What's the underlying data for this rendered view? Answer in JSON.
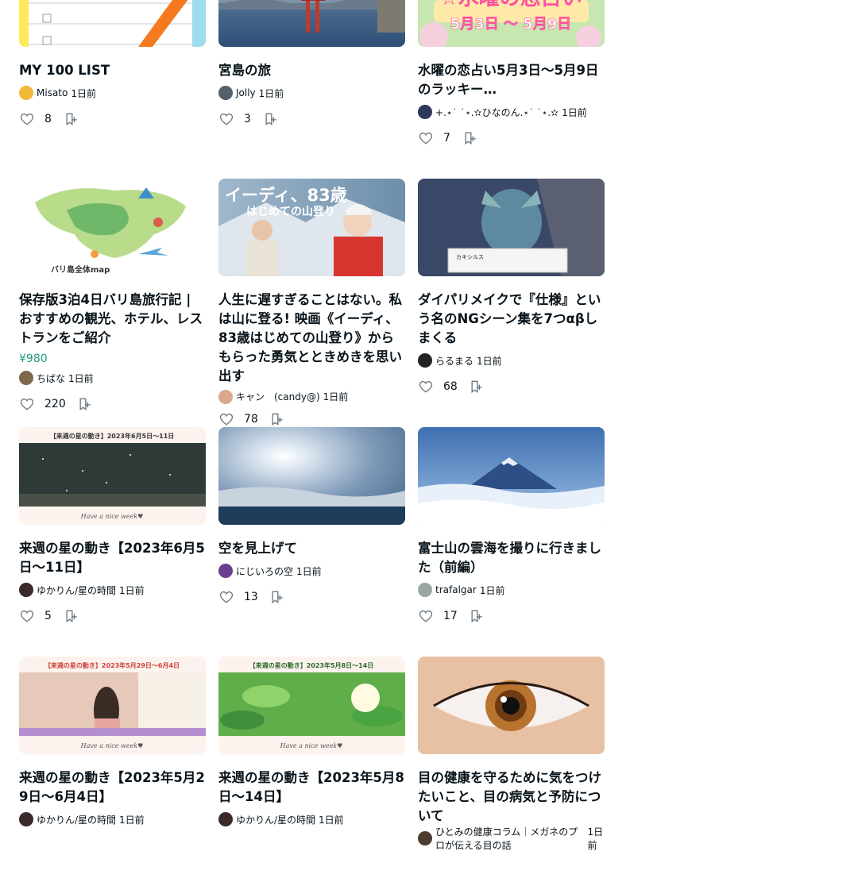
{
  "cards": [
    {
      "title": "MY 100 LIST",
      "author": "Misato",
      "time": "1日前",
      "likes": "8",
      "price": "",
      "av": "#f3b73a"
    },
    {
      "title": "宮島の旅",
      "author": "Jolly",
      "time": "1日前",
      "likes": "3",
      "price": "",
      "av": "#55606a"
    },
    {
      "title": "水曜の恋占い5月3日〜5月9日のラッキー…",
      "author": "+.⋆˙ ˙⋆.✫ひなのん.⋆˙ ˙⋆.✫",
      "time": "1日前",
      "likes": "7",
      "price": "",
      "av": "#2d3a5b"
    },
    {
      "title": "保存版3泊4日バリ島旅行記 | おすすめの観光、ホテル、レストランをご紹介",
      "author": "ちばな",
      "time": "1日前",
      "likes": "220",
      "price": "¥980",
      "av": "#7c6a4a"
    },
    {
      "title": "人生に遅すぎることはない。私は山に登る! 映画《イーディ、83歳はじめての山登り》からもらった勇気とときめきを思い出す",
      "author": "キャン　(candy@)",
      "time": "1日前",
      "likes": "78",
      "price": "",
      "av": "#d9a88d"
    },
    {
      "title": "ダイパリメイクで『仕様』という名のNGシーン集を7つαβしまくる",
      "author": "らるまる",
      "time": "1日前",
      "likes": "68",
      "price": "",
      "av": "#222"
    },
    {
      "title": "来週の星の動き【2023年6月5日〜11日】",
      "author": "ゆかりん/星の時間",
      "time": "1日前",
      "likes": "5",
      "price": "",
      "av": "#3b2a2a"
    },
    {
      "title": "空を見上げて",
      "author": "にじいろの空",
      "time": "1日前",
      "likes": "13",
      "price": "",
      "av": "#6b3f8f"
    },
    {
      "title": "富士山の雲海を撮りに行きました（前編）",
      "author": "trafalgar",
      "time": "1日前",
      "likes": "17",
      "price": "",
      "av": "#9aa7a0"
    },
    {
      "title": "来週の星の動き【2023年5月29日〜6月4日】",
      "author": "ゆかりん/星の時間",
      "time": "1日前",
      "likes": "",
      "price": "",
      "av": "#3b2a2a"
    },
    {
      "title": "来週の星の動き【2023年5月8日〜14日】",
      "author": "ゆかりん/星の時間",
      "time": "1日前",
      "likes": "",
      "price": "",
      "av": "#3b2a2a"
    },
    {
      "title": "目の健康を守るために気をつけたいこと、目の病気と予防について",
      "author": "ひとみの健康コラム｜メガネのプロが伝える目の話",
      "time": "1日前",
      "likes": "",
      "price": "",
      "av": "#4a3c30"
    }
  ],
  "thumb_text": {
    "c3_top": "☆水曜の恋占い",
    "c3_bottom": "5月3日 〜 5月9日",
    "c4_label": "バリ島全体map",
    "c5_title": "イーディ、83歳",
    "c5_sub": "はじめての山登り",
    "c6_label": "カキシルス",
    "star1": "【来週の星の動き】2023年6月5日〜11日",
    "star2": "【来週の星の動き】2023年5月29日〜6月4日",
    "star3": "【来週の星の動き】2023年5月8日〜14日",
    "week": "Have a nice week♥"
  },
  "colors": {
    "accent_price": "#249c7f",
    "text": "#08131a",
    "icon": "#6b7780"
  }
}
